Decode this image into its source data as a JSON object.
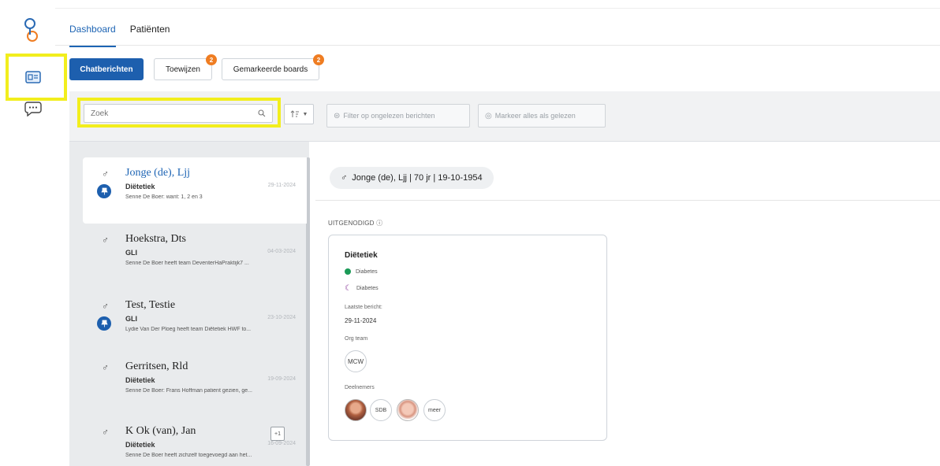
{
  "tabs": [
    {
      "label": "Dashboard",
      "active": true
    },
    {
      "label": "Patiënten",
      "active": false
    }
  ],
  "actions": {
    "chat_label": "Chatberichten",
    "assign_label": "Toewijzen",
    "assign_badge": "2",
    "marked_label": "Gemarkeerde boards",
    "marked_badge": "2"
  },
  "filters": {
    "search_placeholder": "Zoek",
    "unread_label": "Filter op ongelezen berichten",
    "mark_read_label": "Markeer alles als gelezen"
  },
  "patients": [
    {
      "name": "Jonge (de), Ljj",
      "type": "Diëtetiek",
      "date": "29-11-2024",
      "message": "Senne De Boer: want: 1, 2 en 3",
      "pinned": true,
      "selected": true
    },
    {
      "name": "Hoekstra, Dts",
      "type": "GLI",
      "date": "04-03-2024",
      "message": "Senne De Boer heeft team DeventerHaPraktijk7 ...",
      "pinned": false
    },
    {
      "name": "Test, Testie",
      "type": "GLI",
      "date": "23-10-2024",
      "message": "Lydie Van Der Ploeg heeft team Diëtetiek HWF to...",
      "pinned": true
    },
    {
      "name": "Gerritsen, Rld",
      "type": "Diëtetiek",
      "date": "19-09-2024",
      "message": "Senne De Boer: Frans Hoffman patient gezien, ge...",
      "pinned": false
    },
    {
      "name": "K Ok (van), Jan",
      "type": "Diëtetiek",
      "date": "16-09-2024",
      "message": "Senne De Boer heeft zichzelf toegevoegd aan het...",
      "pinned": false,
      "extra": "+1"
    }
  ],
  "detail": {
    "header": "Jonge (de), Ljj | 70 jr | 19-10-1954",
    "invited_label": "UITGENODIGD",
    "card": {
      "title": "Diëtetiek",
      "tag1": "Diabetes",
      "tag2": "Diabetes",
      "last_label": "Laatste bericht:",
      "last_date": "29-11-2024",
      "org_label": "Org team",
      "org_value": "MCW",
      "members_label": "Deelnemers",
      "member_initials": "SDB",
      "more_label": "meer"
    }
  },
  "colors": {
    "primary": "#1d5fae",
    "badge": "#ef7d22",
    "highlight": "#f2ee1d",
    "green": "#1b9a57"
  }
}
